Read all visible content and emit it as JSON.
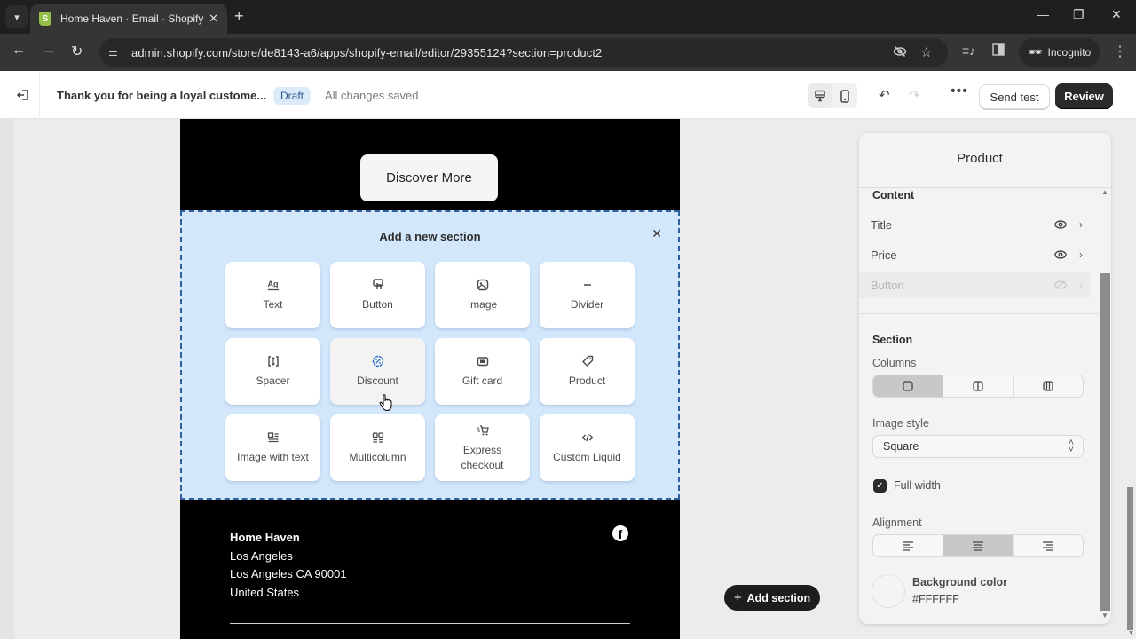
{
  "browser": {
    "tab_title": "Home Haven · Email · Shopify",
    "url": "admin.shopify.com/store/de8143-a6/apps/shopify-email/editor/29355124?section=product2",
    "profile_label": "Incognito"
  },
  "header": {
    "email_title": "Thank you for being a loyal custome...",
    "status_badge": "Draft",
    "save_status": "All changes saved",
    "send_test_label": "Send test",
    "review_label": "Review",
    "device_active": "desktop"
  },
  "email": {
    "cta_label": "Discover More",
    "add_section_panel": {
      "title": "Add a new section",
      "tiles": [
        {
          "label": "Text",
          "icon": "text-icon"
        },
        {
          "label": "Button",
          "icon": "button-icon"
        },
        {
          "label": "Image",
          "icon": "image-icon"
        },
        {
          "label": "Divider",
          "icon": "divider-icon"
        },
        {
          "label": "Spacer",
          "icon": "spacer-icon"
        },
        {
          "label": "Discount",
          "icon": "discount-icon"
        },
        {
          "label": "Gift card",
          "icon": "gift-card-icon"
        },
        {
          "label": "Product",
          "icon": "product-tag-icon"
        },
        {
          "label": "Image with text",
          "icon": "image-with-text-icon"
        },
        {
          "label": "Multicolumn",
          "icon": "multicolumn-icon"
        },
        {
          "label": "Express checkout",
          "icon": "express-checkout-icon"
        },
        {
          "label": "Custom Liquid",
          "icon": "code-icon"
        }
      ],
      "hovered_tile": "Discount"
    },
    "footer": {
      "brand": "Home Haven",
      "city": "Los Angeles",
      "address": "Los Angeles CA 90001",
      "country": "United States",
      "social": "facebook"
    }
  },
  "canvas": {
    "add_section_label": "Add section"
  },
  "sidebar": {
    "title": "Product",
    "content_group": "Content",
    "content_items": [
      {
        "label": "Title",
        "visible": true,
        "enabled": true
      },
      {
        "label": "Price",
        "visible": true,
        "enabled": true
      },
      {
        "label": "Button",
        "visible": false,
        "enabled": false
      }
    ],
    "section_group": "Section",
    "columns_label": "Columns",
    "columns_options": [
      "1",
      "2",
      "3"
    ],
    "columns_selected": "1",
    "image_style_label": "Image style",
    "image_style_value": "Square",
    "full_width_label": "Full width",
    "full_width_checked": true,
    "alignment_label": "Alignment",
    "alignment_options": [
      "left",
      "center",
      "right"
    ],
    "alignment_selected": "center",
    "background_color_label": "Background color",
    "background_color_value": "#FFFFFF"
  },
  "colors": {
    "panel_highlight": "#d3e7fb",
    "panel_border": "#2f5f9e",
    "primary_button": "#2a2a2a",
    "draft_badge": "#dbe9f8"
  }
}
